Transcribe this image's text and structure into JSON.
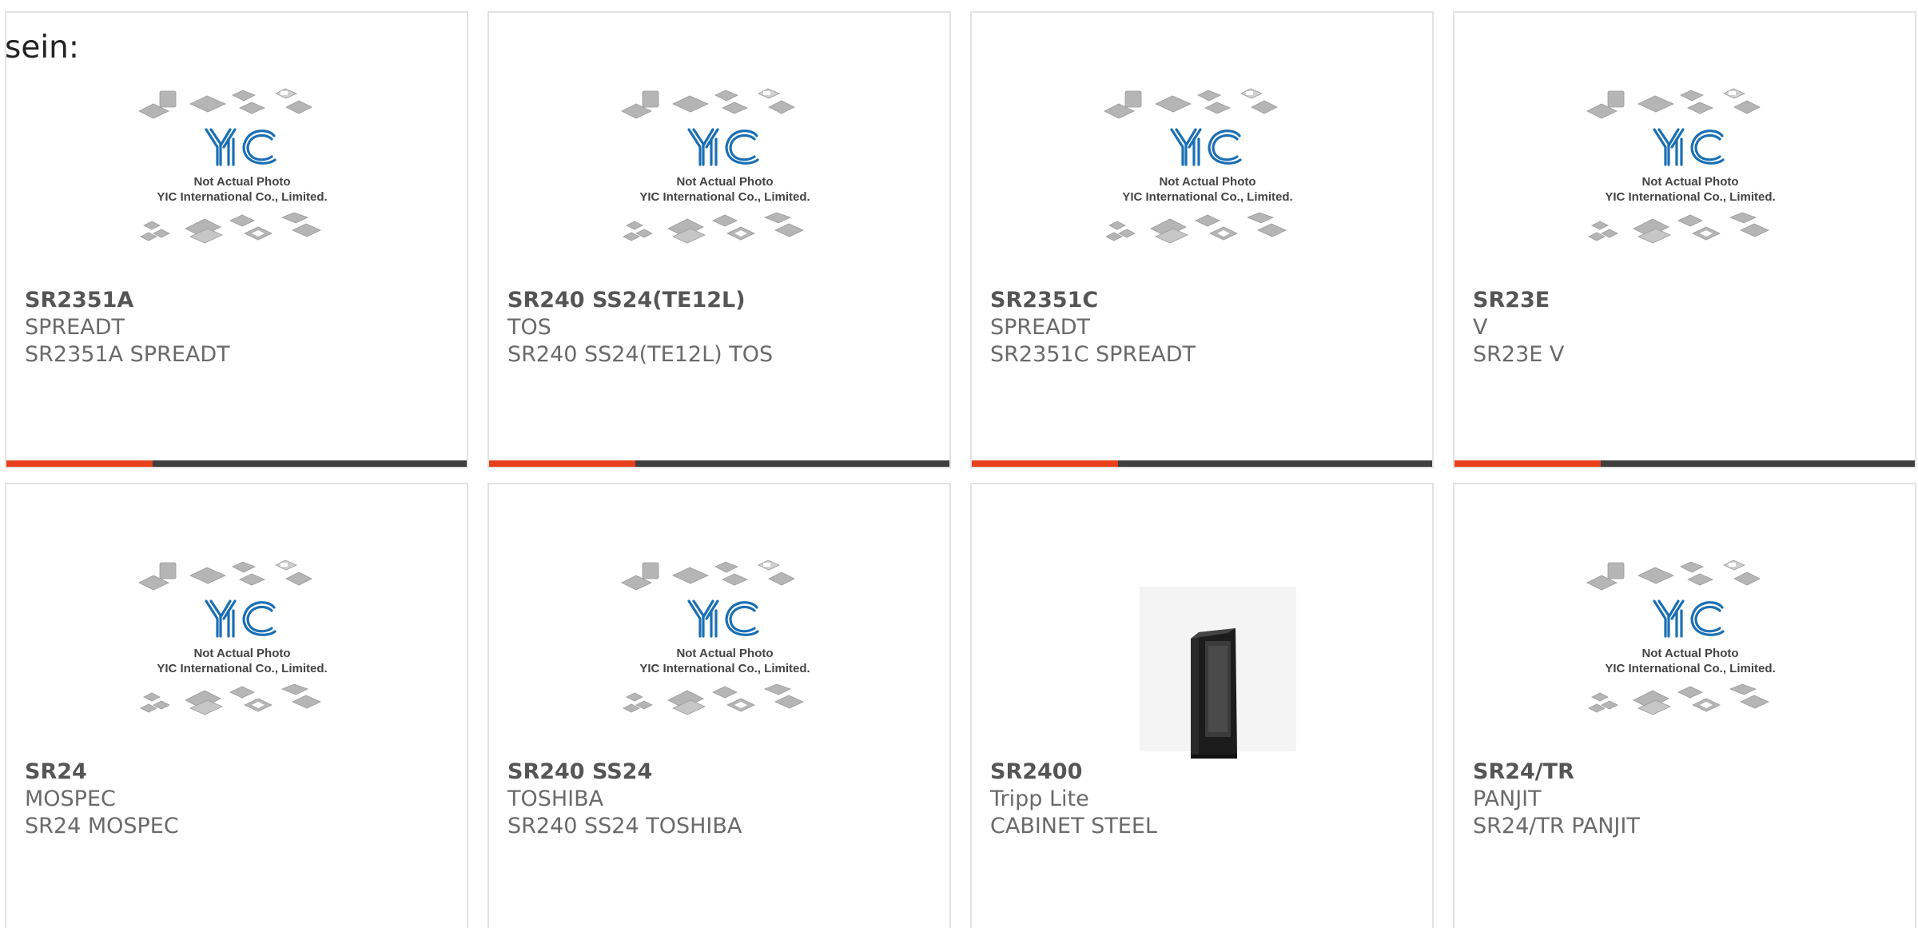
{
  "fragment_text": "sein:",
  "colors": {
    "accent": "#e8401c",
    "bar_dark": "#3f3f3f",
    "logo_blue": "#1a6fb5",
    "chip_gray": "#b3b3b3"
  },
  "placeholder": {
    "line1": "Not Actual Photo",
    "line2": "YIC International Co., Limited."
  },
  "products": [
    {
      "part": "SR2351A",
      "manufacturer": "SPREADT",
      "description": "SR2351A SPREADT",
      "image": "placeholder"
    },
    {
      "part": "SR240 SS24(TE12L)",
      "manufacturer": "TOS",
      "description": "SR240 SS24(TE12L) TOS",
      "image": "placeholder"
    },
    {
      "part": "SR2351C",
      "manufacturer": "SPREADT",
      "description": "SR2351C SPREADT",
      "image": "placeholder"
    },
    {
      "part": "SR23E",
      "manufacturer": "V",
      "description": "SR23E V",
      "image": "placeholder"
    },
    {
      "part": "SR24",
      "manufacturer": "MOSPEC",
      "description": "SR24 MOSPEC",
      "image": "placeholder"
    },
    {
      "part": "SR240 SS24",
      "manufacturer": "TOSHIBA",
      "description": "SR240 SS24 TOSHIBA",
      "image": "placeholder"
    },
    {
      "part": "SR2400",
      "manufacturer": "Tripp Lite",
      "description": "CABINET STEEL",
      "image": "cabinet-photo"
    },
    {
      "part": "SR24/TR",
      "manufacturer": "PANJIT",
      "description": "SR24/TR PANJIT",
      "image": "placeholder"
    }
  ]
}
